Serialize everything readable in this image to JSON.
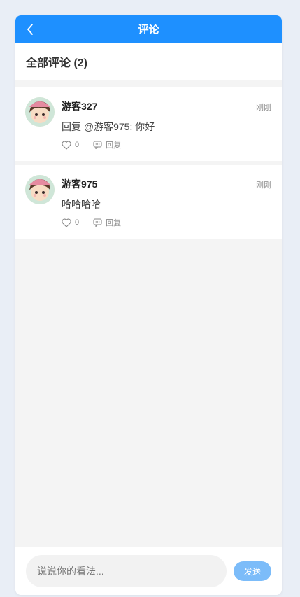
{
  "nav": {
    "title": "评论"
  },
  "section": {
    "title": "全部评论 (2)"
  },
  "comments": [
    {
      "user": "游客327",
      "time": "刚刚",
      "content": "回复 @游客975: 你好",
      "likes": "0",
      "reply_label": "回复"
    },
    {
      "user": "游客975",
      "time": "刚刚",
      "content": "哈哈哈哈",
      "likes": "0",
      "reply_label": "回复"
    }
  ],
  "composer": {
    "placeholder": "说说你的看法...",
    "send_label": "发送"
  },
  "colors": {
    "accent": "#1e90ff",
    "send_button": "#7cbcf9"
  }
}
